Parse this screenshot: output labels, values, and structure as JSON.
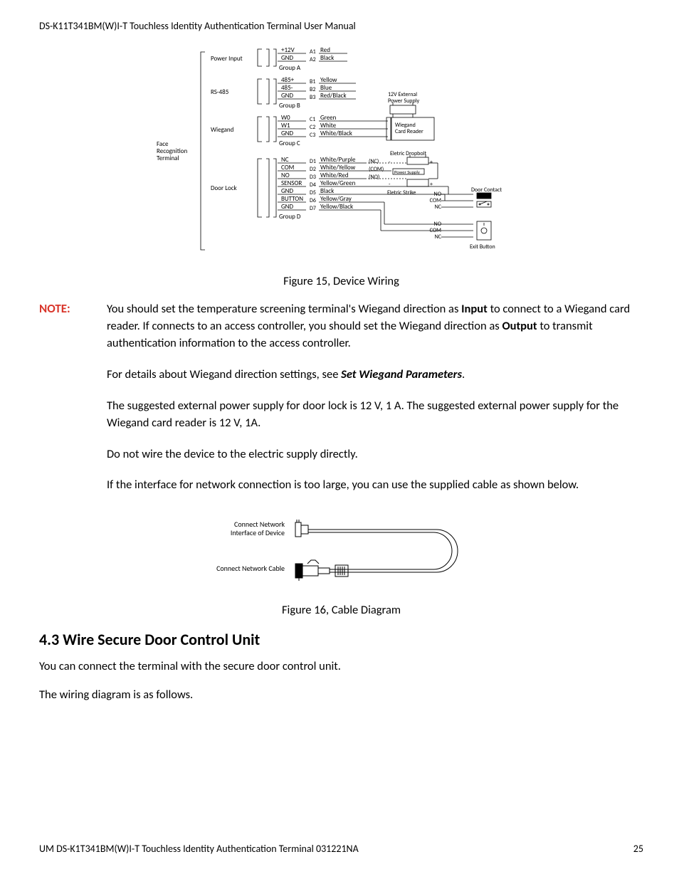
{
  "header": "DS-K11T341BM(W)I-T Touchless Identity Authentication Terminal User Manual",
  "fig15_caption": "Figure 15, Device Wiring",
  "note_label": "NOTE:",
  "note": {
    "p1a": "You should set the temperature screening terminal's Wiegand direction as ",
    "p1b": "Input",
    "p1c": " to connect to a Wiegand card reader. If connects to an access controller, you should set the Wiegand direction as ",
    "p1d": "Output",
    "p1e": " to transmit authentication information to the access controller.",
    "p2a": "For details about Wiegand direction settings, see ",
    "p2b": "Set Wiegand Parameters",
    "p2c": ".",
    "p3": "The suggested external power supply for door lock is 12 V, 1 A. The suggested external power supply for the Wiegand card reader is 12 V, 1A.",
    "p4": "Do not wire the device to the electric supply directly.",
    "p5": "If the interface for network connection is too large, you can use the supplied cable as shown below."
  },
  "fig16_caption": "Figure 16, Cable Diagram",
  "section_heading": "4.3 Wire Secure Door Control Unit",
  "body1": "You can connect the terminal with the secure door control unit.",
  "body2": "The wiring diagram is as follows.",
  "footer_left": "UM DS-K1T341BM(W)I-T Touchless Identity Authentication Terminal 031221NA",
  "footer_right": "25",
  "wiring": {
    "terminal_label_l1": "Face",
    "terminal_label_l2": "Recognition",
    "terminal_label_l3": "Terminal",
    "groups": {
      "A": {
        "name": "Power Input",
        "glabel": "Group A",
        "rows": [
          {
            "sig": "+12V",
            "pin": "A1",
            "color": "Red"
          },
          {
            "sig": "GND",
            "pin": "A2",
            "color": "Black"
          }
        ]
      },
      "B": {
        "name": "RS-485",
        "glabel": "Group B",
        "rows": [
          {
            "sig": "485+",
            "pin": "B1",
            "color": "Yellow"
          },
          {
            "sig": "485-",
            "pin": "B2",
            "color": "Blue"
          },
          {
            "sig": "GND",
            "pin": "B3",
            "color": "Red/Black"
          }
        ]
      },
      "C": {
        "name": "Wiegand",
        "glabel": "Group C",
        "rows": [
          {
            "sig": "W0",
            "pin": "C1",
            "color": "Green"
          },
          {
            "sig": "W1",
            "pin": "C2",
            "color": "White"
          },
          {
            "sig": "GND",
            "pin": "C3",
            "color": "White/Black"
          }
        ]
      },
      "D": {
        "name": "Door Lock",
        "glabel": "Group D",
        "rows": [
          {
            "sig": "NC",
            "pin": "D1",
            "color": "White/Purple"
          },
          {
            "sig": "COM",
            "pin": "D2",
            "color": "White/Yellow"
          },
          {
            "sig": "NO",
            "pin": "D3",
            "color": "White/Red"
          },
          {
            "sig": "SENSOR",
            "pin": "D4",
            "color": "Yellow/Green"
          },
          {
            "sig": "GND",
            "pin": "D5",
            "color": "Black"
          },
          {
            "sig": "BUTTON",
            "pin": "D6",
            "color": "Yellow/Gray"
          },
          {
            "sig": "GND",
            "pin": "D7",
            "color": "Yellow/Black"
          }
        ]
      }
    },
    "right_labels": {
      "ext_ps": "12V External",
      "ext_ps2": "Power Supply",
      "wiegand_reader1": "Wiegand",
      "wiegand_reader2": "Card Reader",
      "dropbolt": "Eletric Dropbolt",
      "nc": "(NC)",
      "com": "(COM)",
      "no": "(NO)",
      "ps": "Power Supply",
      "strike": "Eletric Strike",
      "door_contact": "Door Contact",
      "no2": "NO",
      "com2": "COM",
      "nc2": "NC",
      "exit": "Exit Button"
    }
  },
  "cable": {
    "l1": "Connect Network",
    "l2": "Interface of Device",
    "l3": "Connect Network Cable"
  }
}
